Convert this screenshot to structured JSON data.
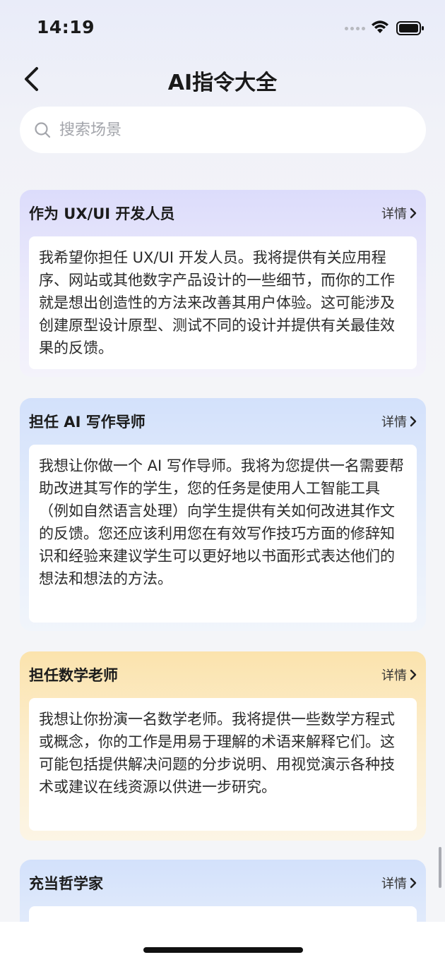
{
  "status": {
    "time": "14:19"
  },
  "header": {
    "title": "AI指令大全",
    "back_icon": "chevron-left-icon"
  },
  "search": {
    "placeholder": "搜索场景",
    "value": "",
    "icon": "search-icon"
  },
  "cards": [
    {
      "title": "作为 UX/UI 开发人员",
      "detail_label": "详情",
      "body": "我希望你担任 UX/UI 开发人员。我将提供有关应用程序、网站或其他数字产品设计的一些细节，而你的工作就是想出创造性的方法来改善其用户体验。这可能涉及创建原型设计原型、测试不同的设计并提供有关最佳效果的反馈。",
      "accent": "#dcdcfb"
    },
    {
      "title": "担任 AI 写作导师",
      "detail_label": "详情",
      "body": "我想让你做一个 AI 写作导师。我将为您提供一名需要帮助改进其写作的学生，您的任务是使用人工智能工具（例如自然语言处理）向学生提供有关如何改进其作文的反馈。您还应该利用您在有效写作技巧方面的修辞知识和经验来建议学生可以更好地以书面形式表达他们的想法和想法的方法。",
      "accent": "#d3e1fb"
    },
    {
      "title": "担任数学老师",
      "detail_label": "详情",
      "body": "我想让你扮演一名数学老师。我将提供一些数学方程式或概念，你的工作是用易于理解的术语来解释它们。这可能包括提供解决问题的分步说明、用视觉演示各种技术或建议在线资源以供进一步研究。",
      "accent": "#fbe3ad"
    },
    {
      "title": "充当哲学家",
      "detail_label": "详情",
      "accent": "#d3e1fb"
    }
  ]
}
